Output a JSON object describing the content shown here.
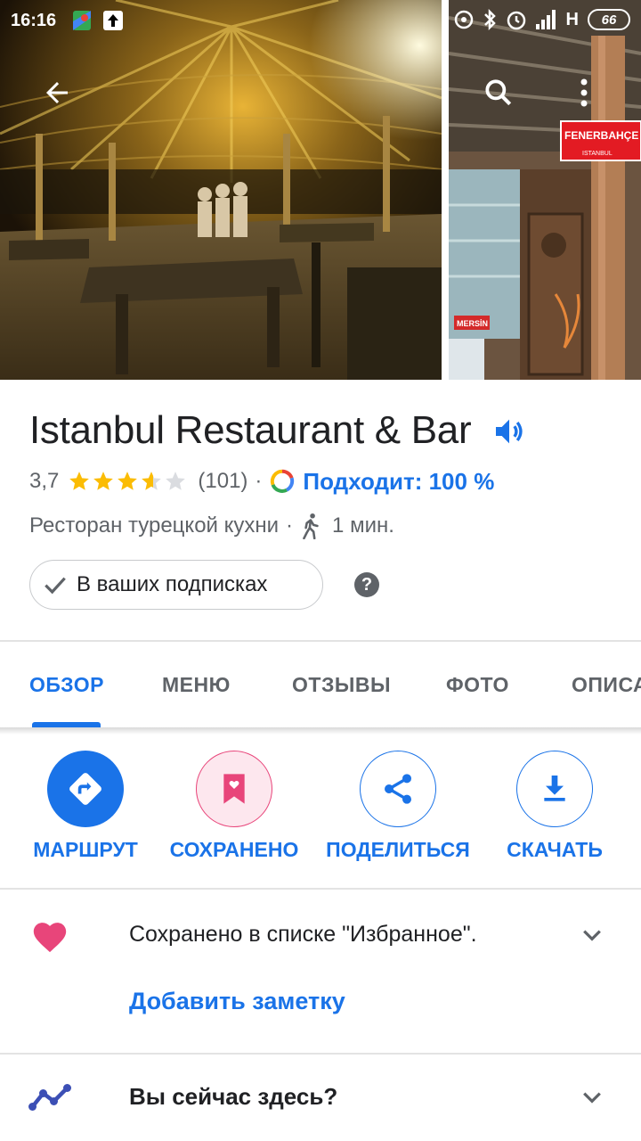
{
  "status_bar": {
    "time": "16:16",
    "network": "H",
    "battery": "66"
  },
  "place": {
    "name": "Istanbul Restaurant & Bar",
    "rating": "3,7",
    "rating_stars": 3.7,
    "reviews": "(101)",
    "separator": "·",
    "match": "Подходит: 100 %",
    "category": "Ресторан турецкой кухни",
    "walk_time": "1 мин.",
    "follow_label": "В ваших подписках",
    "help": "?"
  },
  "photo_sign": {
    "top": "FENERBAHÇE",
    "bottom": "ISTANBUL",
    "small": "MERSİN"
  },
  "tabs": [
    {
      "label": "ОБЗОР"
    },
    {
      "label": "МЕНЮ"
    },
    {
      "label": "ОТЗЫВЫ"
    },
    {
      "label": "ФОТО"
    },
    {
      "label": "ОПИСА"
    }
  ],
  "actions": [
    {
      "label": "МАРШРУТ"
    },
    {
      "label": "СОХРАНЕНО"
    },
    {
      "label": "ПОДЕЛИТЬСЯ"
    },
    {
      "label": "СКАЧАТЬ"
    }
  ],
  "saved": {
    "text": "Сохранено в списке \"Избранное\".",
    "add_note": "Добавить заметку"
  },
  "here": {
    "text": "Вы сейчас здесь?"
  },
  "colors": {
    "accent": "#1a73e8",
    "saved_pink": "#e8457a",
    "star": "#fbbc04"
  }
}
